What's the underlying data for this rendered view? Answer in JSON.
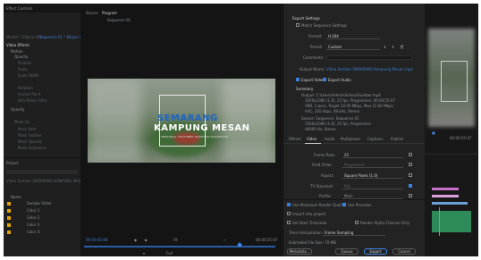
{
  "left_panel": {
    "tab": "Effect Controls",
    "header": "Master * Ellipse 001",
    "header_link": "Sequence 01 * Ellipse 001",
    "rows": [
      {
        "text": "Video Effects",
        "style": "white"
      },
      {
        "text": "Motion",
        "style": ""
      },
      {
        "text": "Opacity",
        "style": ""
      },
      {
        "text": "Position",
        "style": "dim"
      },
      {
        "text": "Scale",
        "style": "dim"
      },
      {
        "text": "Scale Width",
        "style": "dim"
      },
      {
        "text": "Rotation",
        "style": "dim"
      },
      {
        "text": "Anchor Point",
        "style": "dim"
      },
      {
        "text": "Anti-flicker Filter",
        "style": "dim"
      },
      {
        "text": "Opacity",
        "style": ""
      },
      {
        "text": "Mask (1)",
        "style": "dim"
      },
      {
        "text": "Mask Path",
        "style": "dim"
      },
      {
        "text": "Mask Feather",
        "style": "dim"
      },
      {
        "text": "Mask Opacity",
        "style": "dim"
      },
      {
        "text": "Mask Expansion",
        "style": "dim"
      }
    ],
    "project_title": "Project",
    "project_path": "Video Sumber SEMARANG KAMPUNG MESAN.prproj",
    "project_header": "Name",
    "project_items": [
      "Sample Video",
      "Color 1",
      "Color 2",
      "Color 3",
      "Color 4"
    ]
  },
  "program": {
    "tabs": [
      "Source",
      "Program"
    ],
    "sequence": "Sequence 01",
    "title_line1": "SEMARANG",
    "title_line2": "KAMPUNG MESAN",
    "title_line3": "PERSONAL YOUTUBER KAMPUNG PARIWISATA",
    "timecode_left": "00:00:45:06",
    "timecode_right": "00:00:55:07",
    "fit": "Fit",
    "quality": "Full"
  },
  "export": {
    "section": "Export Settings",
    "match_sequence": "Match Sequence Settings",
    "format_label": "Format:",
    "format": "H.264",
    "preset_label": "Preset:",
    "preset": "Custom",
    "comments_label": "Comments:",
    "output_label": "Output Name:",
    "output_name": "Video Sumber SEMARANG Kampung Mesan.mp4",
    "export_video": "Export Video",
    "export_audio": "Export Audio",
    "summary_title": "Summary",
    "summary_lines": [
      "Output: C:\\Users\\Admin\\Videos\\Sumber.mp4",
      "1920x1080 (1.0), 25 fps, Progressive, 00:00:55:07",
      "VBR, 1 pass, Target 10.00 Mbps, Max 12.00 Mbps",
      "AAC, 320 kbps, 48 kHz, Stereo",
      "Source: Sequence, Sequence 01",
      "1920x1080 (1.0), 25 fps, Progressive",
      "48000 Hz, Stereo"
    ],
    "tabs": [
      "Effects",
      "Video",
      "Audio",
      "Multiplexer",
      "Captions",
      "Publish"
    ],
    "active_tab": 1,
    "video_rows": [
      {
        "label": "Frame Rate:",
        "value": "25"
      },
      {
        "label": "Field Order:",
        "value": "Progressive"
      },
      {
        "label": "Aspect:",
        "value": "Square Pixels (1.0)"
      },
      {
        "label": "TV Standard:",
        "value": "PAL"
      },
      {
        "label": "Profile:",
        "value": "Main"
      }
    ],
    "max_render": "Use Maximum Render Quality",
    "use_previews": "Use Previews",
    "import_project": "Import into project",
    "set_start": "Set Start Timecode",
    "render_alpha": "Render Alpha Channel Only",
    "interp_label": "Time Interpolation:",
    "interp": "Frame Sampling",
    "filesize": "Estimated File Size: 70 MB",
    "buttons": {
      "metadata": "Metadata...",
      "queue": "Queue",
      "export": "Export",
      "cancel": "Cancel"
    }
  },
  "timeline": {
    "timecode": "00:00:55:07"
  }
}
